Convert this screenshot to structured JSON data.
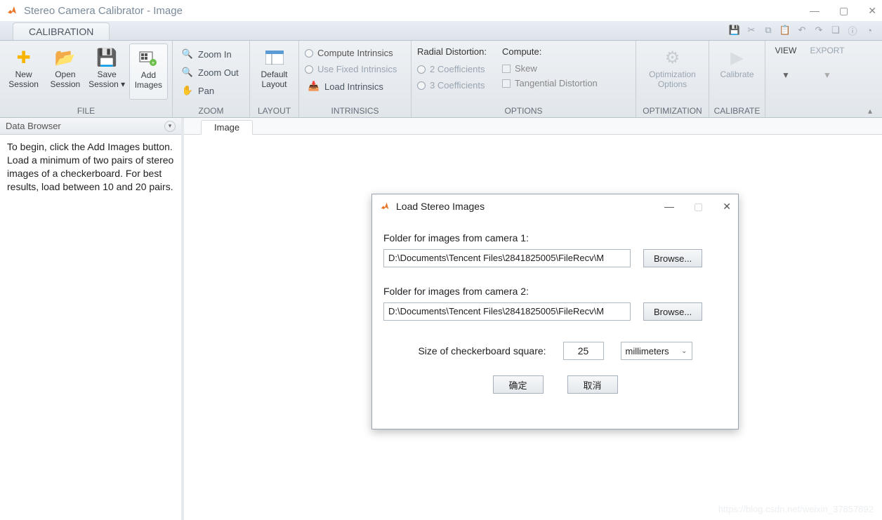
{
  "window": {
    "title": "Stereo Camera Calibrator - Image"
  },
  "tabstrip": {
    "main_tab": "CALIBRATION"
  },
  "ribbon": {
    "file": {
      "label": "FILE",
      "new": "New\nSession",
      "open": "Open\nSession",
      "save": "Save\nSession",
      "add": "Add\nImages"
    },
    "zoom": {
      "label": "ZOOM",
      "zoomin": "Zoom In",
      "zoomout": "Zoom Out",
      "pan": "Pan"
    },
    "layout": {
      "label": "LAYOUT",
      "default": "Default\nLayout"
    },
    "intrinsics": {
      "label": "INTRINSICS",
      "compute": "Compute Intrinsics",
      "fixed": "Use Fixed Intrinsics",
      "load": "Load Intrinsics"
    },
    "options": {
      "label": "OPTIONS",
      "radial_hdr": "Radial Distortion:",
      "c2": "2 Coefficients",
      "c3": "3 Coefficients",
      "compute_hdr": "Compute:",
      "skew": "Skew",
      "tang": "Tangential Distortion"
    },
    "optimization": {
      "label": "OPTIMIZATION",
      "btn": "Optimization\nOptions"
    },
    "calibrate": {
      "label": "CALIBRATE",
      "btn": "Calibrate"
    },
    "view": {
      "label": "VIEW"
    },
    "export": {
      "label": "EXPORT"
    }
  },
  "databrowser": {
    "title": "Data Browser",
    "text": "To begin, click the Add Images button. Load a minimum of two pairs of stereo images of a checkerboard. For best results, load between 10 and 20 pairs."
  },
  "doc": {
    "tab": "Image"
  },
  "dialog": {
    "title": "Load Stereo Images",
    "lbl1": "Folder for images from camera 1:",
    "path1": "D:\\Documents\\Tencent Files\\2841825005\\FileRecv\\M",
    "browse": "Browse...",
    "lbl2": "Folder for images from camera 2:",
    "path2": "D:\\Documents\\Tencent Files\\2841825005\\FileRecv\\M",
    "size_lbl": "Size of checkerboard square:",
    "size_val": "25",
    "unit": "millimeters",
    "ok": "确定",
    "cancel": "取消"
  },
  "watermark": "https://blog.csdn.net/weixin_37857892"
}
